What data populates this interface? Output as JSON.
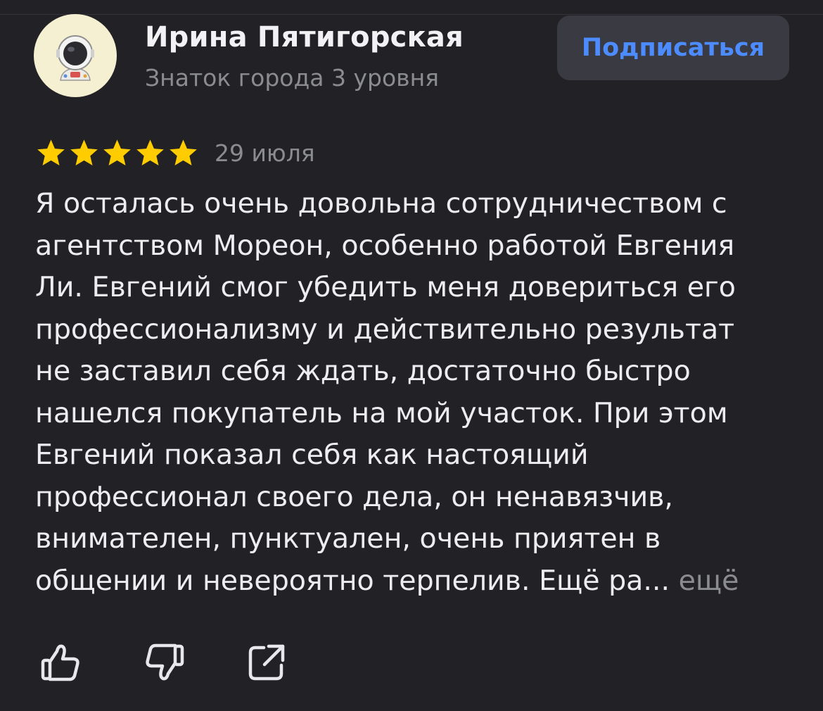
{
  "author": {
    "name": "Ирина Пятигорская",
    "level": "Знаток города 3 уровня",
    "avatar_icon": "astronaut-icon"
  },
  "subscribe_button": {
    "label": "Подписаться"
  },
  "review": {
    "rating": 5,
    "rating_max": 5,
    "date": "29 июля",
    "text_lines": [
      "Я осталась очень довольна сотрудничеством с",
      "агентством Мореон, особенно работой Евгения",
      "Ли. Евгений смог убедить меня довериться его",
      "профессионализму и действительно результат",
      "не заставил себя ждать, достаточно быстро",
      "нашелся покупатель на мой участок. При этом",
      "Евгений показал себя как настоящий",
      "профессионал своего дела, он ненавязчив,",
      "внимателен, пунктуален, очень приятен в",
      "общении и невероятно терпелив. Ещё ра..."
    ],
    "more_label": "ещё"
  },
  "actions": {
    "like_icon": "thumbs-up-icon",
    "dislike_icon": "thumbs-down-icon",
    "share_icon": "share-icon"
  },
  "colors": {
    "background": "#222226",
    "text_primary": "#f2f2f4",
    "text_secondary": "#8b8b92",
    "accent_blue": "#4d8cff",
    "button_bg": "#3a3b42",
    "star": "#ffcc00",
    "avatar_bg": "#f6f0d2"
  }
}
